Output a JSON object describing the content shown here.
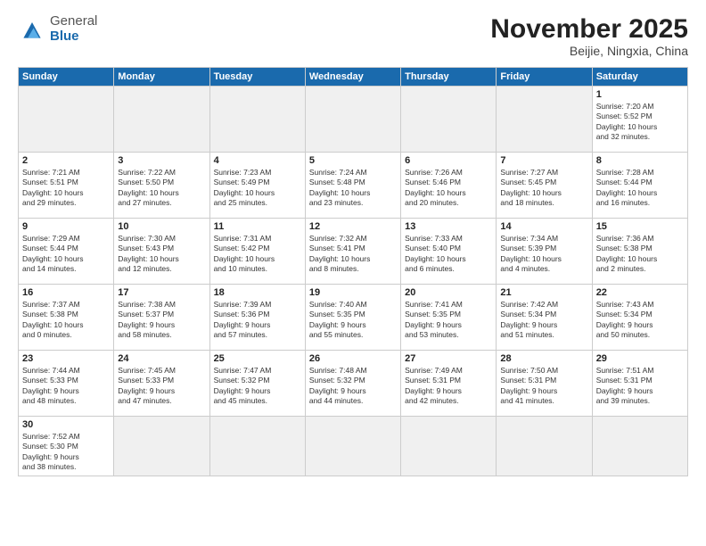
{
  "logo": {
    "general": "General",
    "blue": "Blue"
  },
  "title": "November 2025",
  "location": "Beijie, Ningxia, China",
  "days": [
    "Sunday",
    "Monday",
    "Tuesday",
    "Wednesday",
    "Thursday",
    "Friday",
    "Saturday"
  ],
  "weeks": [
    [
      {
        "day": "",
        "info": ""
      },
      {
        "day": "",
        "info": ""
      },
      {
        "day": "",
        "info": ""
      },
      {
        "day": "",
        "info": ""
      },
      {
        "day": "",
        "info": ""
      },
      {
        "day": "",
        "info": ""
      },
      {
        "day": "1",
        "info": "Sunrise: 7:20 AM\nSunset: 5:52 PM\nDaylight: 10 hours\nand 32 minutes."
      }
    ],
    [
      {
        "day": "2",
        "info": "Sunrise: 7:21 AM\nSunset: 5:51 PM\nDaylight: 10 hours\nand 29 minutes."
      },
      {
        "day": "3",
        "info": "Sunrise: 7:22 AM\nSunset: 5:50 PM\nDaylight: 10 hours\nand 27 minutes."
      },
      {
        "day": "4",
        "info": "Sunrise: 7:23 AM\nSunset: 5:49 PM\nDaylight: 10 hours\nand 25 minutes."
      },
      {
        "day": "5",
        "info": "Sunrise: 7:24 AM\nSunset: 5:48 PM\nDaylight: 10 hours\nand 23 minutes."
      },
      {
        "day": "6",
        "info": "Sunrise: 7:26 AM\nSunset: 5:46 PM\nDaylight: 10 hours\nand 20 minutes."
      },
      {
        "day": "7",
        "info": "Sunrise: 7:27 AM\nSunset: 5:45 PM\nDaylight: 10 hours\nand 18 minutes."
      },
      {
        "day": "8",
        "info": "Sunrise: 7:28 AM\nSunset: 5:44 PM\nDaylight: 10 hours\nand 16 minutes."
      }
    ],
    [
      {
        "day": "9",
        "info": "Sunrise: 7:29 AM\nSunset: 5:44 PM\nDaylight: 10 hours\nand 14 minutes."
      },
      {
        "day": "10",
        "info": "Sunrise: 7:30 AM\nSunset: 5:43 PM\nDaylight: 10 hours\nand 12 minutes."
      },
      {
        "day": "11",
        "info": "Sunrise: 7:31 AM\nSunset: 5:42 PM\nDaylight: 10 hours\nand 10 minutes."
      },
      {
        "day": "12",
        "info": "Sunrise: 7:32 AM\nSunset: 5:41 PM\nDaylight: 10 hours\nand 8 minutes."
      },
      {
        "day": "13",
        "info": "Sunrise: 7:33 AM\nSunset: 5:40 PM\nDaylight: 10 hours\nand 6 minutes."
      },
      {
        "day": "14",
        "info": "Sunrise: 7:34 AM\nSunset: 5:39 PM\nDaylight: 10 hours\nand 4 minutes."
      },
      {
        "day": "15",
        "info": "Sunrise: 7:36 AM\nSunset: 5:38 PM\nDaylight: 10 hours\nand 2 minutes."
      }
    ],
    [
      {
        "day": "16",
        "info": "Sunrise: 7:37 AM\nSunset: 5:38 PM\nDaylight: 10 hours\nand 0 minutes."
      },
      {
        "day": "17",
        "info": "Sunrise: 7:38 AM\nSunset: 5:37 PM\nDaylight: 9 hours\nand 58 minutes."
      },
      {
        "day": "18",
        "info": "Sunrise: 7:39 AM\nSunset: 5:36 PM\nDaylight: 9 hours\nand 57 minutes."
      },
      {
        "day": "19",
        "info": "Sunrise: 7:40 AM\nSunset: 5:35 PM\nDaylight: 9 hours\nand 55 minutes."
      },
      {
        "day": "20",
        "info": "Sunrise: 7:41 AM\nSunset: 5:35 PM\nDaylight: 9 hours\nand 53 minutes."
      },
      {
        "day": "21",
        "info": "Sunrise: 7:42 AM\nSunset: 5:34 PM\nDaylight: 9 hours\nand 51 minutes."
      },
      {
        "day": "22",
        "info": "Sunrise: 7:43 AM\nSunset: 5:34 PM\nDaylight: 9 hours\nand 50 minutes."
      }
    ],
    [
      {
        "day": "23",
        "info": "Sunrise: 7:44 AM\nSunset: 5:33 PM\nDaylight: 9 hours\nand 48 minutes."
      },
      {
        "day": "24",
        "info": "Sunrise: 7:45 AM\nSunset: 5:33 PM\nDaylight: 9 hours\nand 47 minutes."
      },
      {
        "day": "25",
        "info": "Sunrise: 7:47 AM\nSunset: 5:32 PM\nDaylight: 9 hours\nand 45 minutes."
      },
      {
        "day": "26",
        "info": "Sunrise: 7:48 AM\nSunset: 5:32 PM\nDaylight: 9 hours\nand 44 minutes."
      },
      {
        "day": "27",
        "info": "Sunrise: 7:49 AM\nSunset: 5:31 PM\nDaylight: 9 hours\nand 42 minutes."
      },
      {
        "day": "28",
        "info": "Sunrise: 7:50 AM\nSunset: 5:31 PM\nDaylight: 9 hours\nand 41 minutes."
      },
      {
        "day": "29",
        "info": "Sunrise: 7:51 AM\nSunset: 5:31 PM\nDaylight: 9 hours\nand 39 minutes."
      }
    ],
    [
      {
        "day": "30",
        "info": "Sunrise: 7:52 AM\nSunset: 5:30 PM\nDaylight: 9 hours\nand 38 minutes."
      },
      {
        "day": "",
        "info": ""
      },
      {
        "day": "",
        "info": ""
      },
      {
        "day": "",
        "info": ""
      },
      {
        "day": "",
        "info": ""
      },
      {
        "day": "",
        "info": ""
      },
      {
        "day": "",
        "info": ""
      }
    ]
  ]
}
